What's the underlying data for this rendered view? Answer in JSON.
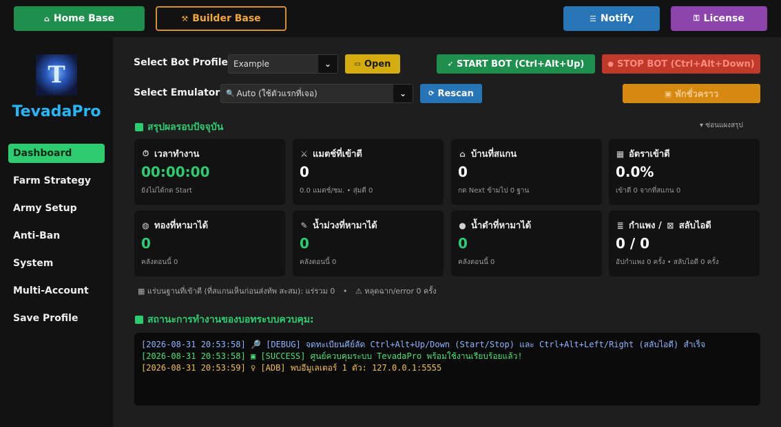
{
  "topbar": {
    "home": {
      "label": "Home Base",
      "icon": "house-icon"
    },
    "builder": {
      "label": "Builder Base",
      "icon": "hammer-icon"
    },
    "notify": {
      "label": "Notify",
      "icon": "scroll-icon"
    },
    "license": {
      "label": "License",
      "icon": "key-lock-icon"
    }
  },
  "sidebar": {
    "logo_letter": "T",
    "brand": "TevadaPro",
    "items": [
      {
        "label": "Dashboard",
        "active": true
      },
      {
        "label": "Farm Strategy"
      },
      {
        "label": "Army Setup"
      },
      {
        "label": "Anti-Ban"
      },
      {
        "label": "System"
      },
      {
        "label": "Multi-Account"
      },
      {
        "label": "Save Profile"
      }
    ]
  },
  "controls": {
    "profile_label": "Select Bot Profile:",
    "profile_value": "Example",
    "open_label": "Open",
    "emulator_label": "Select Emulator:",
    "emulator_value": "Auto (ใช้ตัวแรกที่เจอ)",
    "rescan_label": "Rescan",
    "start_label": "START BOT (Ctrl+Alt+Up)",
    "stop_label": "STOP BOT (Ctrl+Alt+Down)",
    "pause_label": "พักชั่วคราว",
    "arrow": "⌄"
  },
  "summary": {
    "title": "สรุปผลรอบปัจจุบัน",
    "collapse": "▾ ซ่อนแผงสรุป",
    "cards": [
      {
        "title": "เวลาทำงาน",
        "value": "00:00:00",
        "sub": "ยังไม่ได้กด Start",
        "icon": "stopwatch-icon",
        "color": "#2ecc71"
      },
      {
        "title": "แมตช์ที่เข้าตี",
        "value": "0",
        "sub": "0.0 แมตช์/ชม. • สุ่มตี 0",
        "icon": "crossed-swords-icon",
        "color": "#ffffff"
      },
      {
        "title": "บ้านที่สแกน",
        "value": "0",
        "sub": "กด Next ข้ามไป 0 ฐาน",
        "icon": "house-icon",
        "color": "#ffffff"
      },
      {
        "title": "อัตราเข้าตี",
        "value": "0.0%",
        "sub": "เข้าตี 0 จากที่สแกน 0",
        "icon": "chart-icon",
        "color": "#ffffff"
      },
      {
        "title": "ทองที่หามาได้",
        "value": "0",
        "sub": "คลังตอนนี้ 0",
        "icon": "money-bag-icon",
        "color": "#2ecc71"
      },
      {
        "title": "น้ำม่วงที่หามาได้",
        "value": "0",
        "sub": "คลังตอนนี้ 0",
        "icon": "potion-icon",
        "color": "#2ecc71"
      },
      {
        "title": "น้ำดำที่หามาได้",
        "value": "0",
        "sub": "คลังตอนนี้ 0",
        "icon": "droplet-icon",
        "color": "#2ecc71"
      },
      {
        "title": "กำแพง / ",
        "title2": "สลับไอดี",
        "value": "0 / 0",
        "sub": "อัปกำแพง 0 ครั้ง • สลับไอดี 0 ครั้ง",
        "icon": "wall-icon",
        "icon2": "swap-icon",
        "color": "#ffffff"
      }
    ],
    "footnote_a": "แร่บนฐานที่เข้าตี (ที่สแกนเห็นก่อนส่งทัพ สะสม): แร่รวม 0",
    "footnote_dot": "•",
    "footnote_b": "หลุดฉาก/error 0 ครั้ง"
  },
  "status": {
    "title": "สถานะการทำงานของบอทระบบควบคุม:",
    "lines": [
      {
        "text": "[2026-08-31 20:53:58] 🔎 [DEBUG] จดทะเบียนคีย์ลัด Ctrl+Alt+Up/Down (Start/Stop) และ Ctrl+Alt+Left/Right (สลับไอดี) สำเร็จ",
        "color": "#8fb4ff"
      },
      {
        "text": "[2026-08-31 20:53:58] ▣ [SUCCESS] ศูนย์ควบคุมระบบ TevadaPro พร้อมใช้งานเรียบร้อยแล้ว!",
        "color": "#4ee07a"
      },
      {
        "text": "[2026-08-31 20:53:59] ♀ [ADB] พบอีมูเลเตอร์ 1 ตัว: 127.0.0.1:5555",
        "color": "#f2c14e"
      }
    ]
  },
  "colors": {
    "accent": "#2ecc71",
    "home": "#1f8f4e",
    "builder": "#d7912a",
    "notify": "#2775b6",
    "license": "#8e44ad",
    "start": "#1f8f4e",
    "stop": "#c0392b",
    "pause": "#d68910",
    "open": "#d4ac0d",
    "rescan": "#2775b6",
    "brand": "#29b6f6"
  }
}
